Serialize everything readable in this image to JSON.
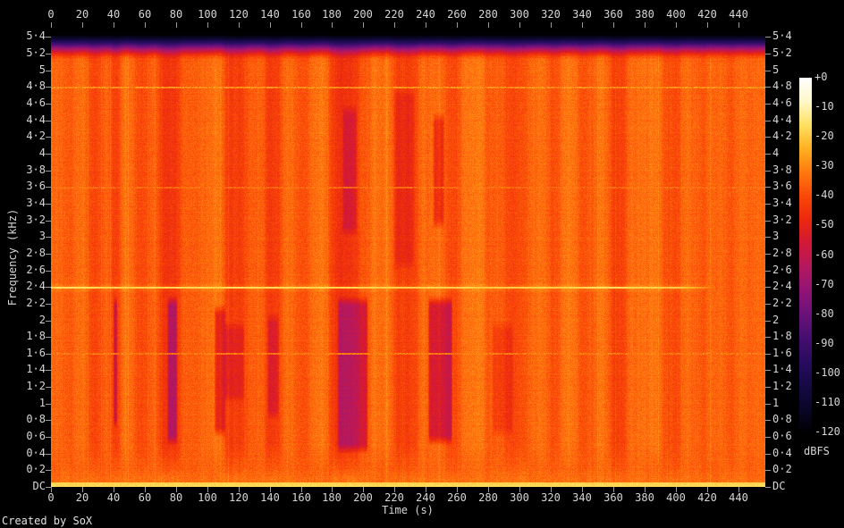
{
  "meta": {
    "creator": "Created by SoX"
  },
  "chart_data": {
    "type": "heatmap",
    "title": "",
    "xlabel": "Time (s)",
    "ylabel": "Frequency (kHz)",
    "colorbar_label": "dBFS",
    "x_range_s": [
      0,
      457
    ],
    "freq_range_khz": [
      0,
      5.5125
    ],
    "db_range": [
      0,
      -120
    ],
    "grid": false,
    "legend_position": "right-colorbar",
    "x_ticks": [
      {
        "label": "0",
        "s": 0
      },
      {
        "label": "20",
        "s": 20
      },
      {
        "label": "40",
        "s": 40
      },
      {
        "label": "60",
        "s": 60
      },
      {
        "label": "80",
        "s": 80
      },
      {
        "label": "100",
        "s": 100
      },
      {
        "label": "120",
        "s": 120
      },
      {
        "label": "140",
        "s": 140
      },
      {
        "label": "160",
        "s": 160
      },
      {
        "label": "180",
        "s": 180
      },
      {
        "label": "200",
        "s": 200
      },
      {
        "label": "220",
        "s": 220
      },
      {
        "label": "240",
        "s": 240
      },
      {
        "label": "260",
        "s": 260
      },
      {
        "label": "280",
        "s": 280
      },
      {
        "label": "300",
        "s": 300
      },
      {
        "label": "320",
        "s": 320
      },
      {
        "label": "340",
        "s": 340
      },
      {
        "label": "360",
        "s": 360
      },
      {
        "label": "380",
        "s": 380
      },
      {
        "label": "400",
        "s": 400
      },
      {
        "label": "420",
        "s": 420
      },
      {
        "label": "440",
        "s": 440
      }
    ],
    "freq_ticks": [
      {
        "label": "DC",
        "khz": 0
      },
      {
        "label": "0·2",
        "khz": 0.2
      },
      {
        "label": "0·4",
        "khz": 0.4
      },
      {
        "label": "0·6",
        "khz": 0.6
      },
      {
        "label": "0·8",
        "khz": 0.8
      },
      {
        "label": "1",
        "khz": 1
      },
      {
        "label": "1·2",
        "khz": 1.2
      },
      {
        "label": "1·4",
        "khz": 1.4
      },
      {
        "label": "1·6",
        "khz": 1.6
      },
      {
        "label": "1·8",
        "khz": 1.8
      },
      {
        "label": "2",
        "khz": 2
      },
      {
        "label": "2·2",
        "khz": 2.2
      },
      {
        "label": "2·4",
        "khz": 2.4
      },
      {
        "label": "2·6",
        "khz": 2.6
      },
      {
        "label": "2·8",
        "khz": 2.8
      },
      {
        "label": "3",
        "khz": 3
      },
      {
        "label": "3·2",
        "khz": 3.2
      },
      {
        "label": "3·4",
        "khz": 3.4
      },
      {
        "label": "3·6",
        "khz": 3.6
      },
      {
        "label": "3·8",
        "khz": 3.8
      },
      {
        "label": "4",
        "khz": 4
      },
      {
        "label": "4·2",
        "khz": 4.2
      },
      {
        "label": "4·4",
        "khz": 4.4
      },
      {
        "label": "4·6",
        "khz": 4.6
      },
      {
        "label": "4·8",
        "khz": 4.8
      },
      {
        "label": "5",
        "khz": 5
      },
      {
        "label": "5·2",
        "khz": 5.2
      },
      {
        "label": "5·4",
        "khz": 5.4
      }
    ],
    "colorbar_ticks": [
      {
        "label": "+0",
        "db": 0
      },
      {
        "label": "-10",
        "db": -10
      },
      {
        "label": "-20",
        "db": -20
      },
      {
        "label": "-30",
        "db": -30
      },
      {
        "label": "-40",
        "db": -40
      },
      {
        "label": "-50",
        "db": -50
      },
      {
        "label": "-60",
        "db": -60
      },
      {
        "label": "-70",
        "db": -70
      },
      {
        "label": "-80",
        "db": -80
      },
      {
        "label": "-90",
        "db": -90
      },
      {
        "label": "-100",
        "db": -100
      },
      {
        "label": "-110",
        "db": -110
      },
      {
        "label": "-120",
        "db": -120
      }
    ],
    "palette_stops": [
      [
        0,
        255,
        255,
        255
      ],
      [
        -8,
        255,
        248,
        200
      ],
      [
        -16,
        255,
        224,
        96
      ],
      [
        -24,
        255,
        176,
        32
      ],
      [
        -32,
        255,
        120,
        16
      ],
      [
        -40,
        250,
        72,
        8
      ],
      [
        -48,
        235,
        40,
        16
      ],
      [
        -56,
        210,
        24,
        56
      ],
      [
        -64,
        180,
        24,
        96
      ],
      [
        -72,
        145,
        20,
        118
      ],
      [
        -80,
        105,
        18,
        122
      ],
      [
        -88,
        70,
        14,
        112
      ],
      [
        -96,
        40,
        12,
        95
      ],
      [
        -104,
        22,
        10,
        70
      ],
      [
        -112,
        10,
        6,
        40
      ],
      [
        -120,
        0,
        0,
        0
      ]
    ],
    "background_db": -36,
    "rolloff": {
      "start_khz": 5.12,
      "end_khz": 5.47
    },
    "dc_line": {
      "below_khz": 0.06,
      "db": -19
    },
    "tonal_lines": [
      {
        "khz": 2.4,
        "db": -15,
        "type": "strong",
        "t_end": 425
      },
      {
        "khz": 4.8,
        "db": -29,
        "type": "faint",
        "t_end": 457
      },
      {
        "khz": 3.6,
        "db": -35,
        "type": "faint",
        "t_end": 457
      },
      {
        "khz": 1.6,
        "db": -33,
        "type": "faint",
        "t_end": 457
      }
    ],
    "bands": [
      [
        0,
        7,
        2
      ],
      [
        7,
        12,
        -3
      ],
      [
        12,
        16,
        0
      ],
      [
        16,
        24,
        2
      ],
      [
        24,
        31,
        -5
      ],
      [
        31,
        39,
        1
      ],
      [
        39,
        43,
        -9
      ],
      [
        43,
        53,
        2
      ],
      [
        53,
        62,
        -4
      ],
      [
        62,
        69,
        0
      ],
      [
        69,
        82,
        -9
      ],
      [
        82,
        100,
        0
      ],
      [
        100,
        110,
        3
      ],
      [
        110,
        125,
        -7
      ],
      [
        125,
        137,
        0
      ],
      [
        137,
        147,
        -8
      ],
      [
        147,
        157,
        1
      ],
      [
        157,
        165,
        -2
      ],
      [
        165,
        179,
        3
      ],
      [
        179,
        196,
        -10
      ],
      [
        196,
        204,
        -2
      ],
      [
        204,
        219,
        3
      ],
      [
        219,
        235,
        -6
      ],
      [
        235,
        252,
        1
      ],
      [
        252,
        262,
        -4
      ],
      [
        262,
        278,
        3
      ],
      [
        278,
        290,
        -1
      ],
      [
        290,
        305,
        -5
      ],
      [
        305,
        318,
        2
      ],
      [
        318,
        326,
        -3
      ],
      [
        326,
        337,
        3
      ],
      [
        337,
        347,
        -2
      ],
      [
        347,
        357,
        2
      ],
      [
        357,
        368,
        -5
      ],
      [
        368,
        380,
        1
      ],
      [
        380,
        392,
        3
      ],
      [
        392,
        403,
        -3
      ],
      [
        403,
        412,
        1
      ],
      [
        412,
        420,
        -1
      ],
      [
        420,
        430,
        2
      ],
      [
        430,
        438,
        -2
      ],
      [
        438,
        457,
        1
      ]
    ],
    "patches": [
      [
        39.5,
        42.5,
        0.7,
        2.3,
        -22
      ],
      [
        74,
        81,
        0.5,
        2.3,
        -20
      ],
      [
        104,
        112,
        0.6,
        2.2,
        -16
      ],
      [
        183,
        203,
        0.4,
        2.3,
        -18
      ],
      [
        186,
        196,
        3.0,
        4.6,
        -10
      ],
      [
        241,
        257,
        0.5,
        2.3,
        -20
      ],
      [
        244,
        252,
        3.1,
        4.5,
        -12
      ],
      [
        110,
        124,
        1.0,
        2.0,
        -8
      ],
      [
        138,
        146,
        0.8,
        2.1,
        -10
      ],
      [
        219,
        233,
        2.6,
        4.8,
        -6
      ],
      [
        282,
        296,
        0.6,
        2.0,
        -6
      ]
    ],
    "axis_color": "#999999",
    "text_color": "#d6d6d6"
  }
}
